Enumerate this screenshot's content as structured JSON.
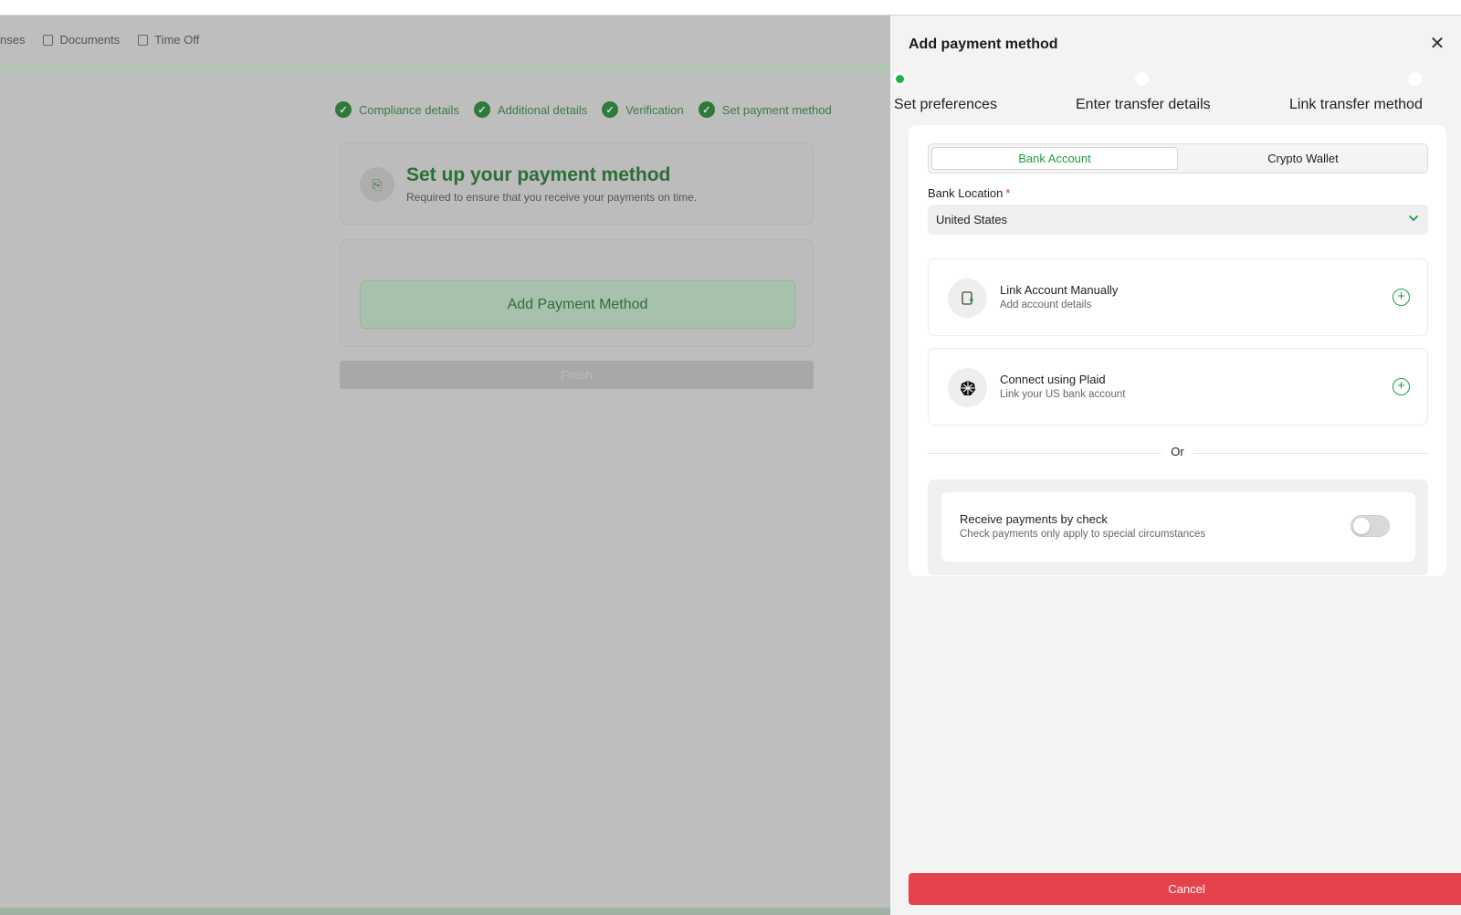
{
  "background_page": {
    "nav": [
      {
        "label": "nses",
        "icon": "none"
      },
      {
        "label": "Documents",
        "icon": "document-icon"
      },
      {
        "label": "Time Off",
        "icon": "calendar-icon"
      }
    ],
    "steps": [
      "Compliance details",
      "Additional details",
      "Verification",
      "Set payment method"
    ],
    "setup_title": "Set up your payment method",
    "setup_subtitle": "Required to ensure that you receive your payments on time.",
    "add_payment_button": "Add Payment Method",
    "finish_button": "Finish"
  },
  "panel": {
    "title": "Add payment method",
    "close_icon": "close-icon",
    "stepper": {
      "active_index": 0,
      "steps": [
        "Set preferences",
        "Enter transfer details",
        "Link transfer method"
      ]
    },
    "tabs": {
      "active": "Bank Account",
      "inactive": "Crypto Wallet"
    },
    "bank_location": {
      "label": "Bank Location",
      "required_mark": "*",
      "value": "United States"
    },
    "options": [
      {
        "title": "Link Account Manually",
        "subtitle": "Add account details",
        "icon": "document-pen-icon"
      },
      {
        "title": "Connect using Plaid",
        "subtitle": "Link your US bank account",
        "icon": "plaid-logo-icon"
      }
    ],
    "divider_text": "Or",
    "check_option": {
      "title": "Receive payments by check",
      "subtitle": "Check payments only apply to special circumstances",
      "enabled": false
    },
    "cancel_button": "Cancel"
  },
  "colors": {
    "accent_green": "#1d9c43",
    "danger_red": "#e5434b",
    "overlay_gray": "#bebebe"
  }
}
